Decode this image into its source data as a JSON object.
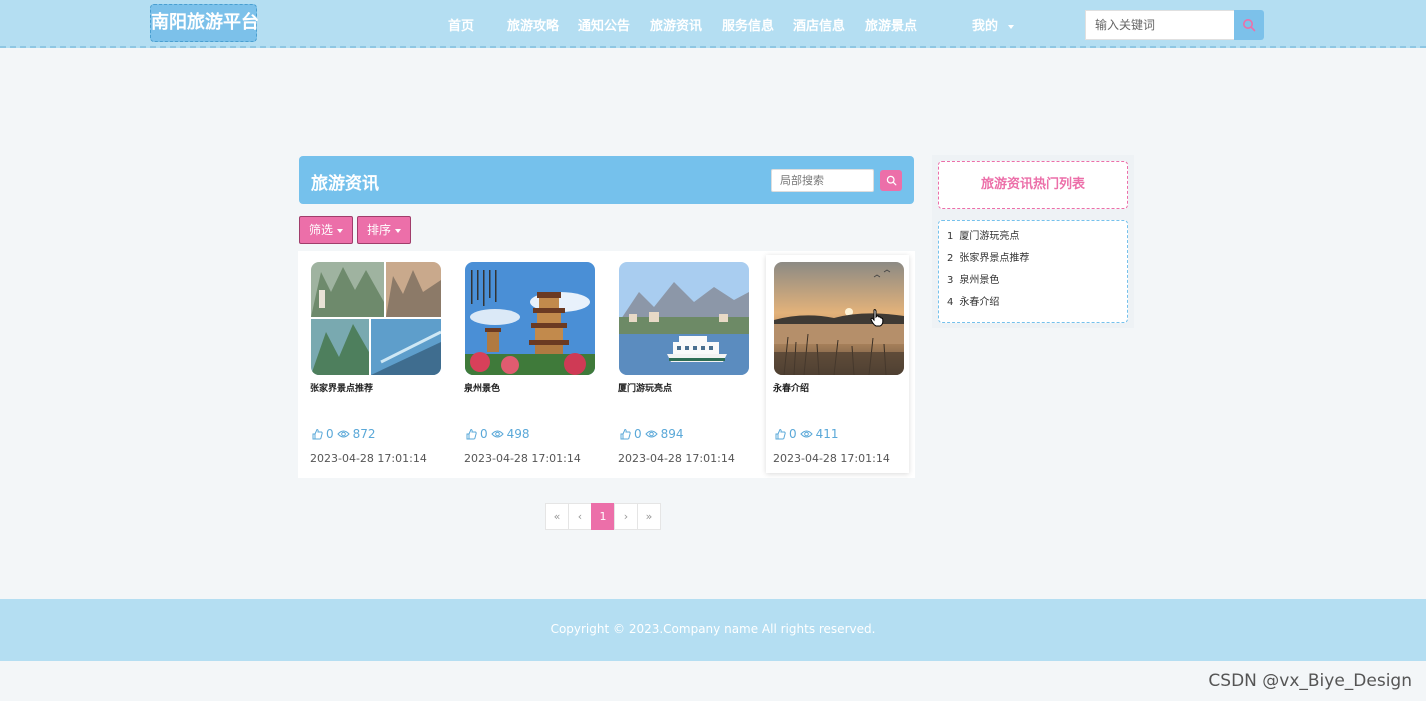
{
  "header": {
    "logo": "南阳旅游平台",
    "nav": [
      {
        "label": "首页"
      },
      {
        "label": "旅游攻略"
      },
      {
        "label": "通知公告"
      },
      {
        "label": "旅游资讯"
      },
      {
        "label": "服务信息"
      },
      {
        "label": "酒店信息"
      },
      {
        "label": "旅游景点"
      }
    ],
    "mine": "我的",
    "search_placeholder": "输入关键词"
  },
  "section": {
    "title": "旅游资讯",
    "search_placeholder": "局部搜索",
    "filter_label": "筛选",
    "sort_label": "排序"
  },
  "cards": [
    {
      "title": "张家界景点推荐",
      "likes": "0",
      "views": "872",
      "date": "2023-04-28 17:01:14"
    },
    {
      "title": "泉州景色",
      "likes": "0",
      "views": "498",
      "date": "2023-04-28 17:01:14"
    },
    {
      "title": "厦门游玩亮点",
      "likes": "0",
      "views": "894",
      "date": "2023-04-28 17:01:14"
    },
    {
      "title": "永春介绍",
      "likes": "0",
      "views": "411",
      "date": "2023-04-28 17:01:14"
    }
  ],
  "pagination": {
    "first": "«",
    "prev": "‹",
    "current": "1",
    "next": "›",
    "last": "»"
  },
  "sidebar": {
    "title": "旅游资讯热门列表",
    "items": [
      {
        "num": "1",
        "label": "厦门游玩亮点"
      },
      {
        "num": "2",
        "label": "张家界景点推荐"
      },
      {
        "num": "3",
        "label": "泉州景色"
      },
      {
        "num": "4",
        "label": "永春介绍"
      }
    ]
  },
  "footer": {
    "copyright": "Copyright © 2023.Company name All rights reserved."
  },
  "watermark": "CSDN @vx_Biye_Design",
  "colors": {
    "accent_blue": "#75c1ec",
    "accent_pink": "#ec6fa9",
    "header_bg": "#b4def2"
  }
}
